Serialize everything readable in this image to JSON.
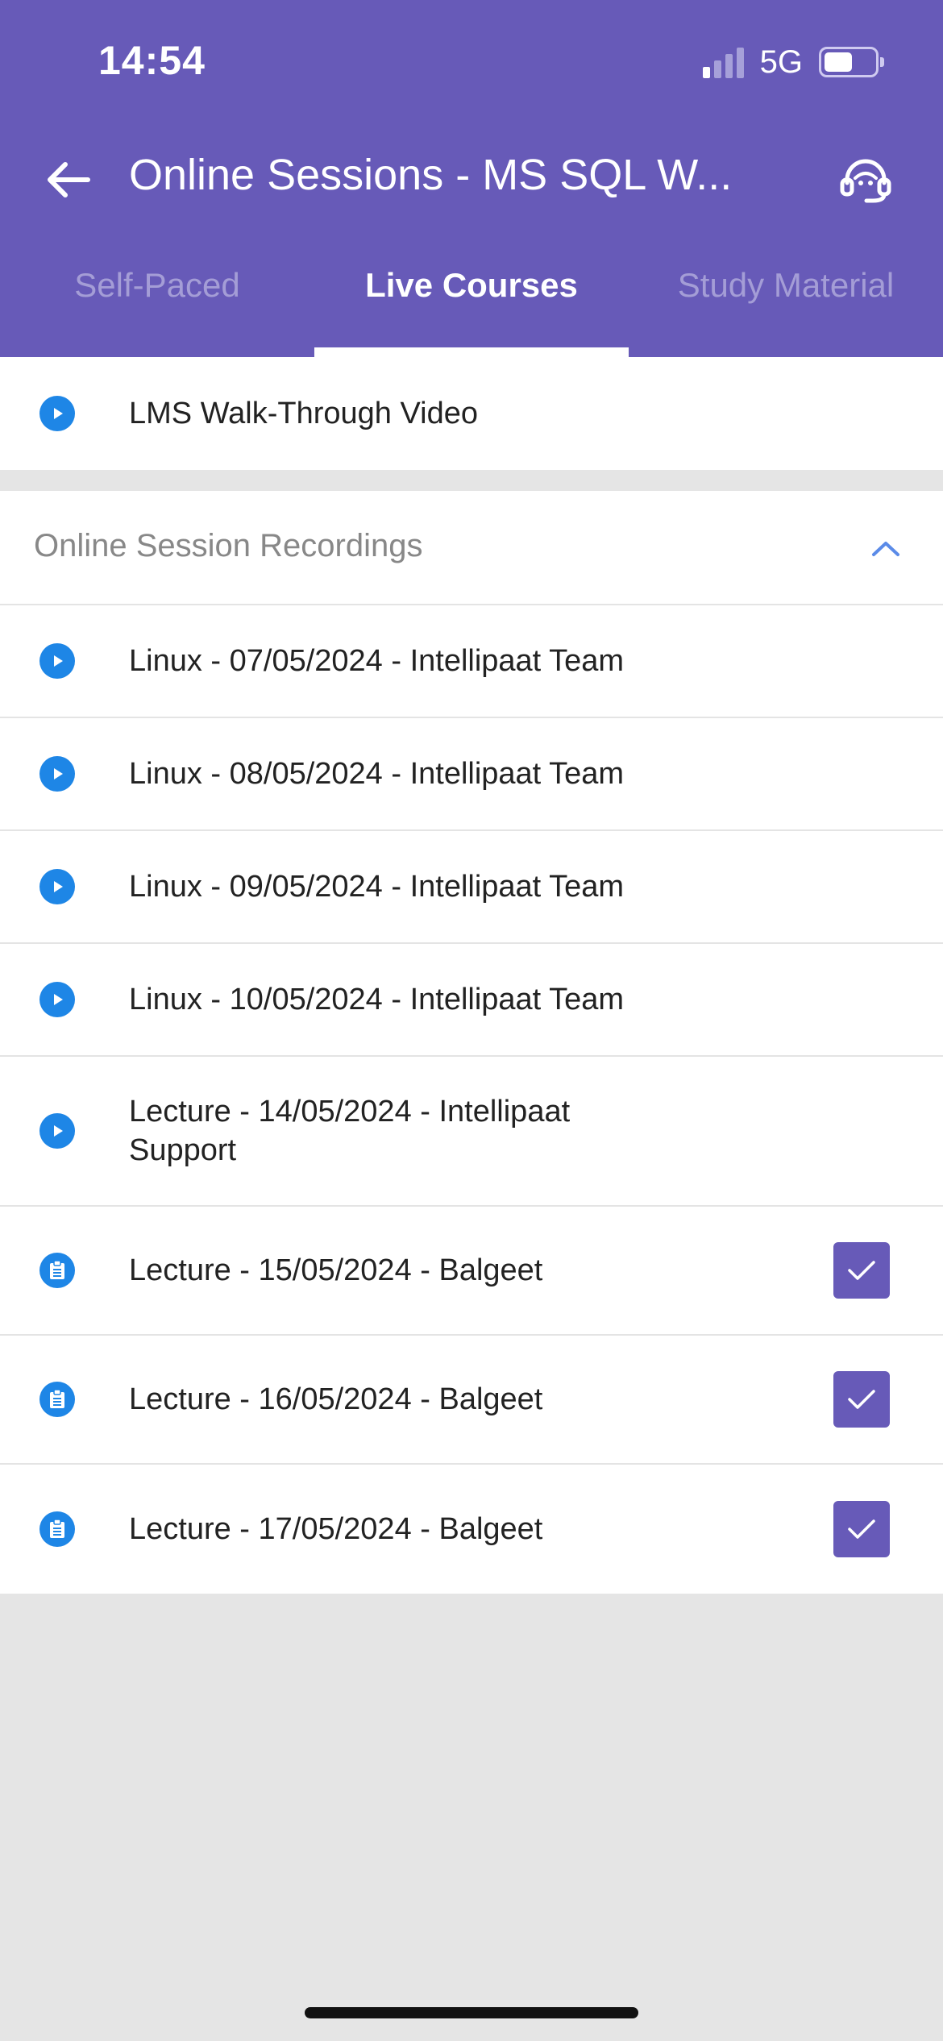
{
  "status_bar": {
    "time": "14:54",
    "network": "5G"
  },
  "toolbar": {
    "title": "Online Sessions - MS SQL W...",
    "back_icon": "arrow-left-icon",
    "support_icon": "headset-icon"
  },
  "tabs": [
    {
      "label": "Self-Paced",
      "active": false
    },
    {
      "label": "Live Courses",
      "active": true
    },
    {
      "label": "Study Material",
      "active": false
    }
  ],
  "walkthrough": {
    "label": "LMS Walk-Through Video",
    "icon": "play-icon"
  },
  "recordings": {
    "header": "Online Session Recordings",
    "expanded": true,
    "items": [
      {
        "label": "Linux - 07/05/2024 - Intellipaat Team",
        "icon": "play-icon",
        "completed": false
      },
      {
        "label": "Linux - 08/05/2024 - Intellipaat Team",
        "icon": "play-icon",
        "completed": false
      },
      {
        "label": "Linux - 09/05/2024 - Intellipaat Team",
        "icon": "play-icon",
        "completed": false
      },
      {
        "label": "Linux - 10/05/2024 - Intellipaat Team",
        "icon": "play-icon",
        "completed": false
      },
      {
        "label_line1": "Lecture - 14/05/2024 - Intellipaat",
        "label_line2": "Support",
        "icon": "play-icon",
        "completed": false
      },
      {
        "label": "Lecture - 15/05/2024 - Balgeet",
        "icon": "document-icon",
        "completed": true
      },
      {
        "label": "Lecture - 16/05/2024 - Balgeet",
        "icon": "document-icon",
        "completed": true
      },
      {
        "label": "Lecture - 17/05/2024 - Balgeet",
        "icon": "document-icon",
        "completed": true
      }
    ]
  },
  "colors": {
    "primary": "#675ab8",
    "accent_blue": "#1e86e6",
    "background": "#e5e5e5"
  }
}
